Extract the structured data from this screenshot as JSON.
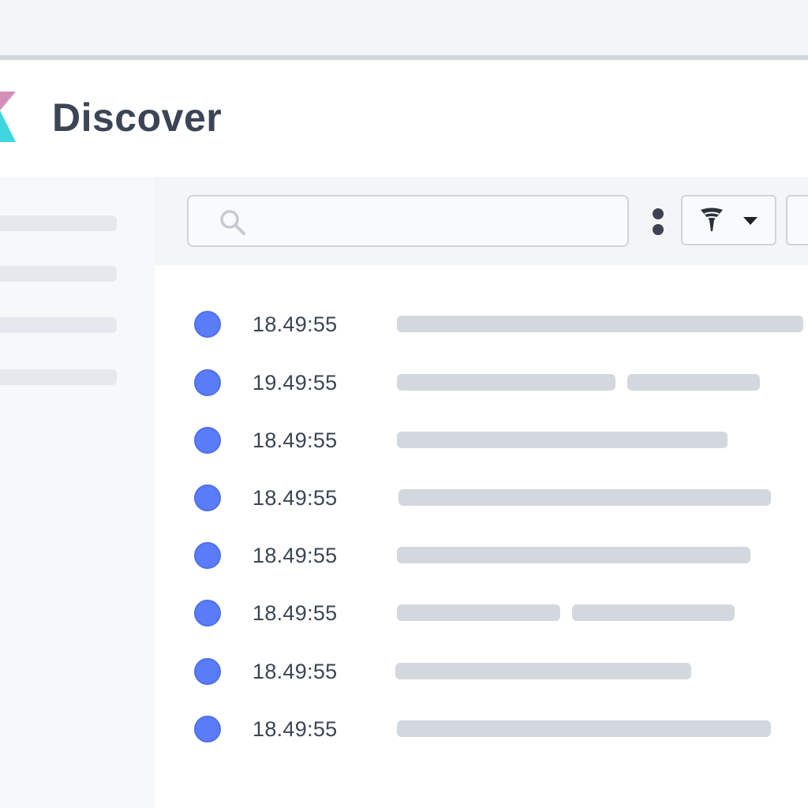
{
  "header": {
    "title": "Discover"
  },
  "search": {
    "value": "",
    "placeholder": ""
  },
  "icons": {
    "search": "search-icon",
    "more": "kebab-menu-icon",
    "filter": "funnel-icon",
    "dropdown": "caret-down-icon",
    "logo": "kibana-logo"
  },
  "colors": {
    "accent": "#5b7cf8",
    "title": "#3b4555",
    "placeholder_bar": "#d3d8de",
    "logo_pink": "#d48fb8",
    "logo_cyan": "#3fd6e0"
  },
  "events": [
    {
      "time": "18.49:55"
    },
    {
      "time": "19.49:55"
    },
    {
      "time": "18.49:55"
    },
    {
      "time": "18.49:55"
    },
    {
      "time": "18.49:55"
    },
    {
      "time": "18.49:55"
    },
    {
      "time": "18.49:55"
    },
    {
      "time": "18.49:55"
    }
  ]
}
